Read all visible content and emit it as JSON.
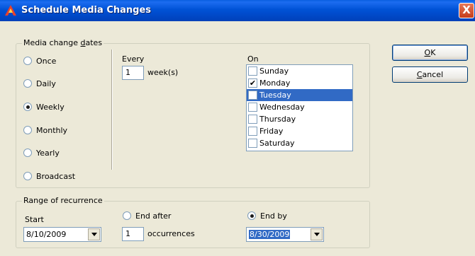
{
  "window": {
    "title": "Schedule Media Changes",
    "close_glyph": "X"
  },
  "media_dates": {
    "legend_pre": "Media change ",
    "legend_mnemonic": "d",
    "legend_post": "ates",
    "options": [
      "Once",
      "Daily",
      "Weekly",
      "Monthly",
      "Yearly",
      "Broadcast"
    ],
    "selected": "Weekly",
    "every_label": "Every",
    "every_value": "1",
    "every_unit": "week(s)",
    "on_label": "On",
    "days": [
      {
        "label": "Sunday",
        "checked": false,
        "selected": false
      },
      {
        "label": "Monday",
        "checked": true,
        "selected": false
      },
      {
        "label": "Tuesday",
        "checked": false,
        "selected": true
      },
      {
        "label": "Wednesday",
        "checked": false,
        "selected": false
      },
      {
        "label": "Thursday",
        "checked": false,
        "selected": false
      },
      {
        "label": "Friday",
        "checked": false,
        "selected": false
      },
      {
        "label": "Saturday",
        "checked": false,
        "selected": false
      }
    ]
  },
  "recurrence": {
    "legend": "Range of recurrence",
    "start_label": "Start",
    "start_value": "8/10/2009",
    "end_after_label": "End after",
    "occurrences_value": "1",
    "occurrences_label": "occurrences",
    "end_by_label": "End by",
    "end_by_value": "8/30/2009",
    "selected": "end_by"
  },
  "buttons": {
    "ok_mnemonic": "O",
    "ok_rest": "K",
    "cancel_mnemonic": "C",
    "cancel_rest": "ancel"
  },
  "colors": {
    "titlebar": "#0046C4",
    "selection": "#316AC5",
    "dialog_bg": "#ECE9D8"
  }
}
